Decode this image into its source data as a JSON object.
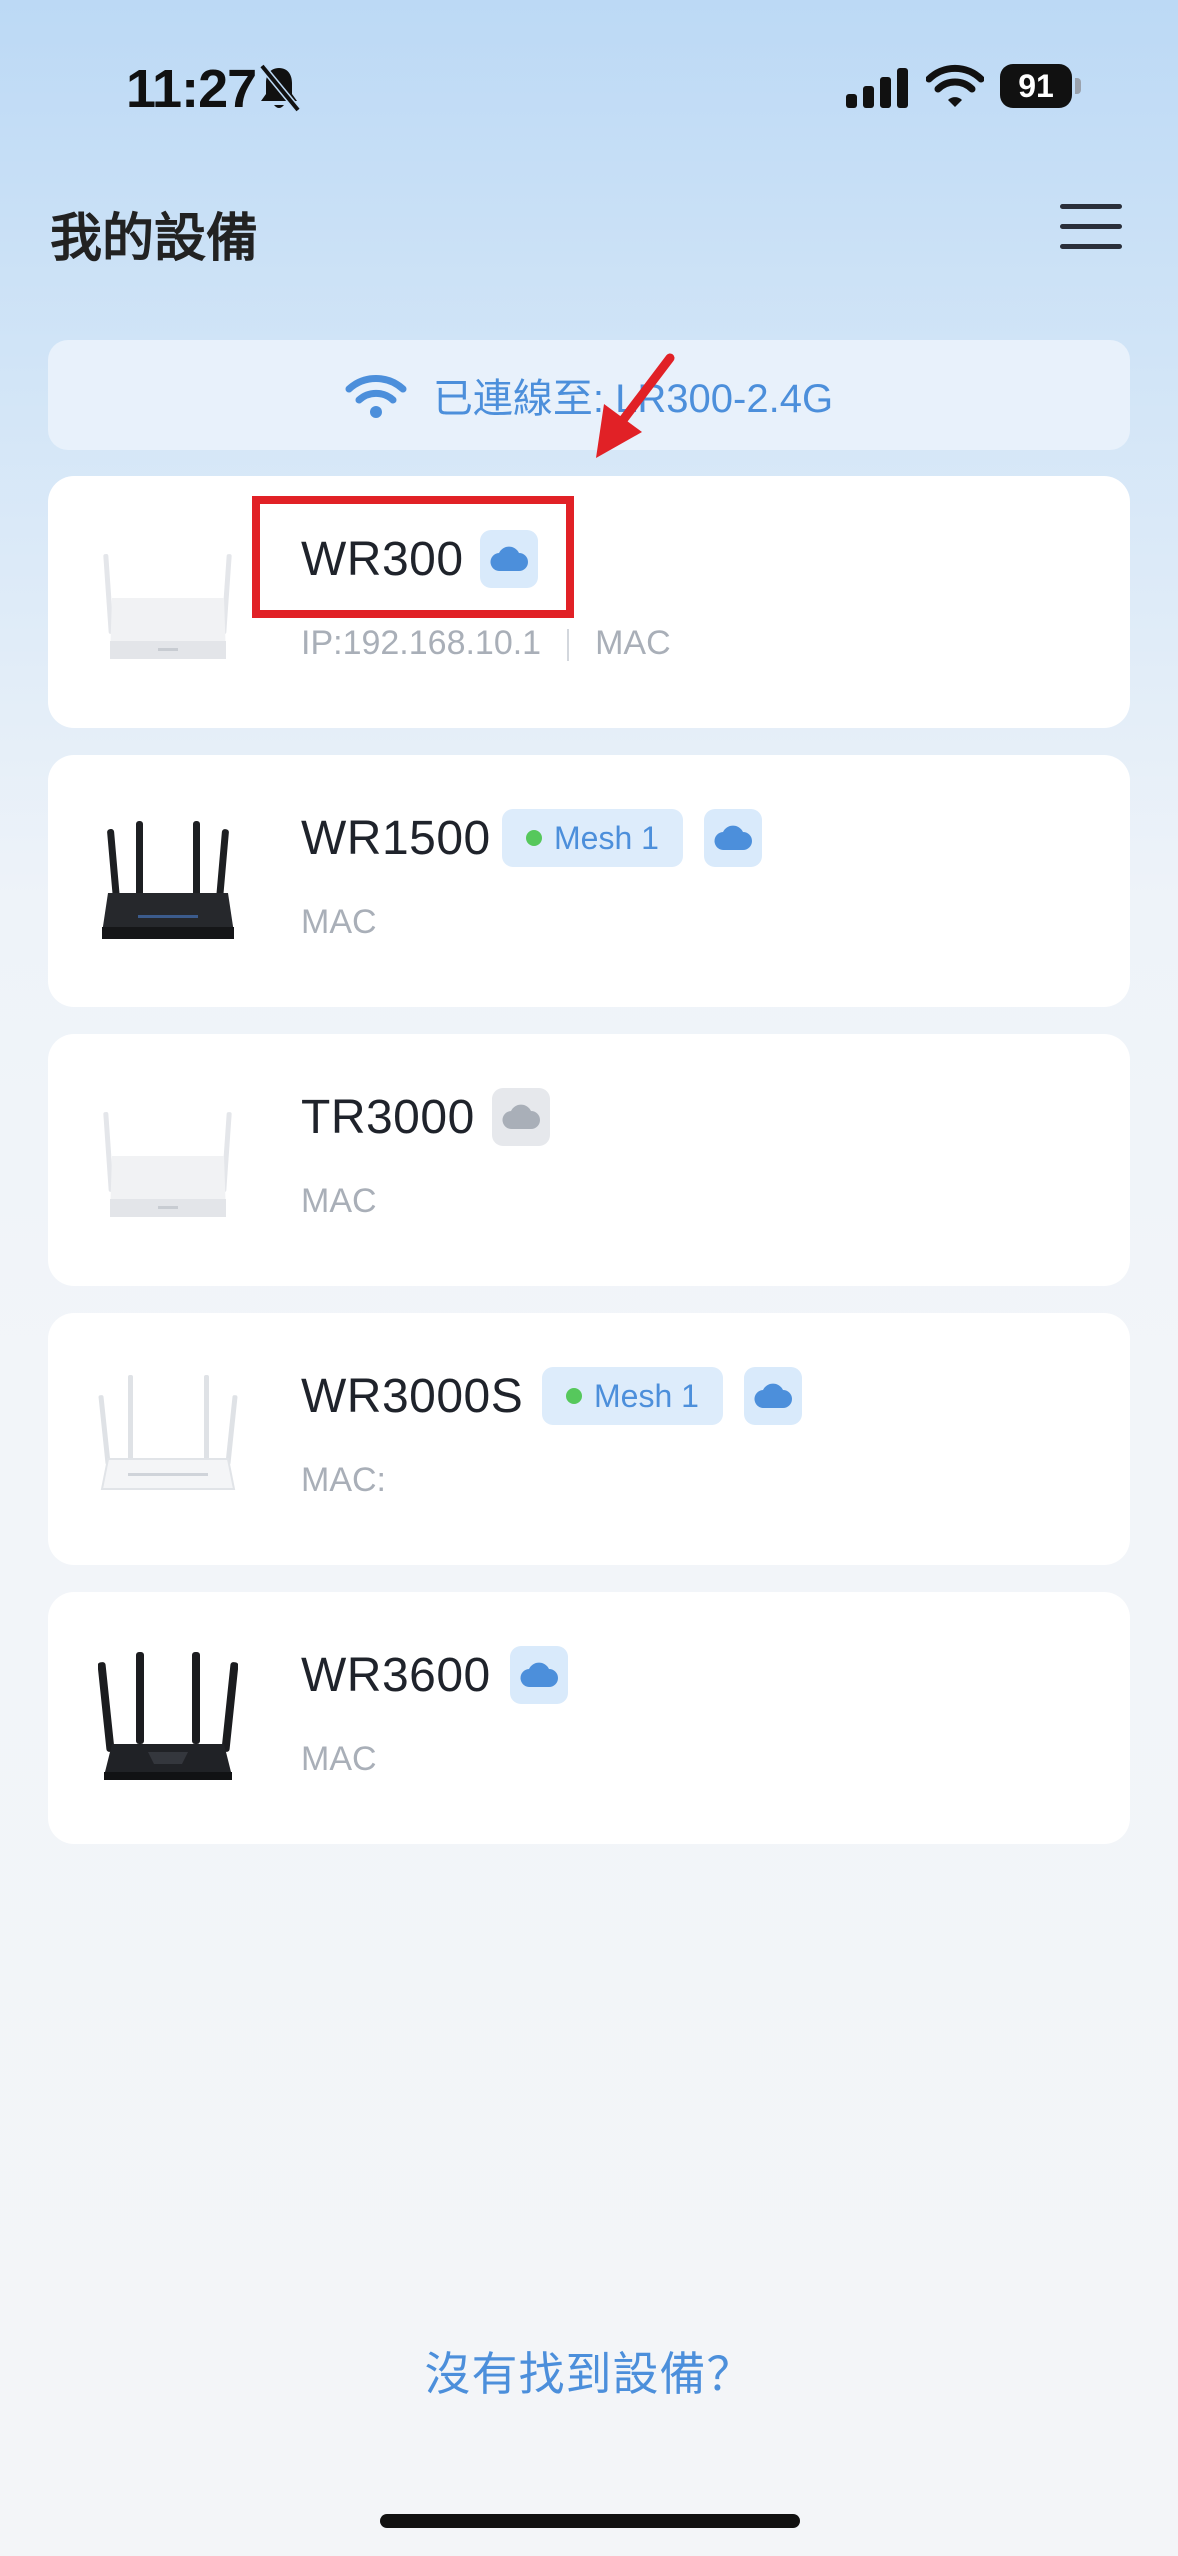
{
  "status_bar": {
    "time": "11:27",
    "battery": "91"
  },
  "header": {
    "title": "我的設備"
  },
  "connection": {
    "label": "已連線至: LR300-2.4G"
  },
  "devices": [
    {
      "name": "WR300",
      "ip": "IP:192.168.10.1",
      "mac": "MAC",
      "cloud": "online"
    },
    {
      "name": "WR1500",
      "mesh": "Mesh 1",
      "mac": "MAC",
      "cloud": "online"
    },
    {
      "name": "TR3000",
      "mac": "MAC",
      "cloud": "offline"
    },
    {
      "name": "WR3000S",
      "mesh": "Mesh 1",
      "mac": "MAC:",
      "cloud": "online"
    },
    {
      "name": "WR3600",
      "mac": "MAC",
      "cloud": "online"
    }
  ],
  "footer": {
    "help_link": "沒有找到設備？"
  },
  "colors": {
    "accent": "#4c8fdb",
    "annotation": "#e12126",
    "mesh_dot": "#56c85c"
  }
}
